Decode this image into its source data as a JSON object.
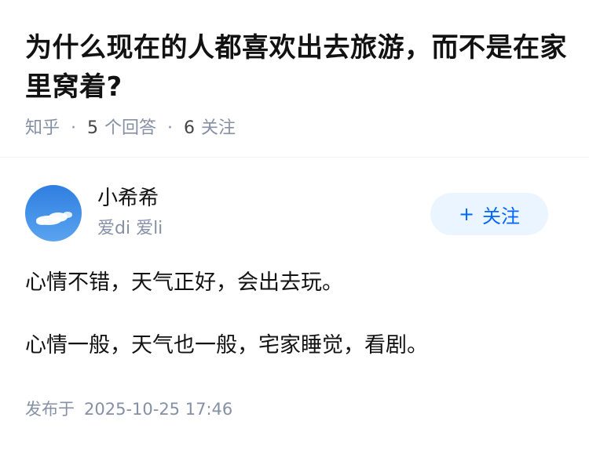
{
  "question": {
    "title": "为什么现在的人都喜欢出去旅游，而不是在家里窝着?",
    "source": "知乎",
    "separator": "·",
    "answers_count": "5",
    "answers_label": "个回答",
    "followers_count": "6",
    "followers_label": "关注"
  },
  "author": {
    "name": "小希希",
    "bio": "爱di 爱li",
    "avatar_icon": "sky-cloud-avatar-icon",
    "follow_plus": "+",
    "follow_label": "关注"
  },
  "answer": {
    "paragraphs": [
      "心情不错，天气正好，会出去玩。",
      "心情一般，天气也一般，宅家睡觉，看剧。"
    ]
  },
  "publish": {
    "label": "发布于",
    "date": "2025-10-25 17:46"
  },
  "colors": {
    "accent": "#0066ff",
    "follow_bg": "#ebf5ff",
    "meta_gray": "#8590a6",
    "text": "#121212"
  }
}
